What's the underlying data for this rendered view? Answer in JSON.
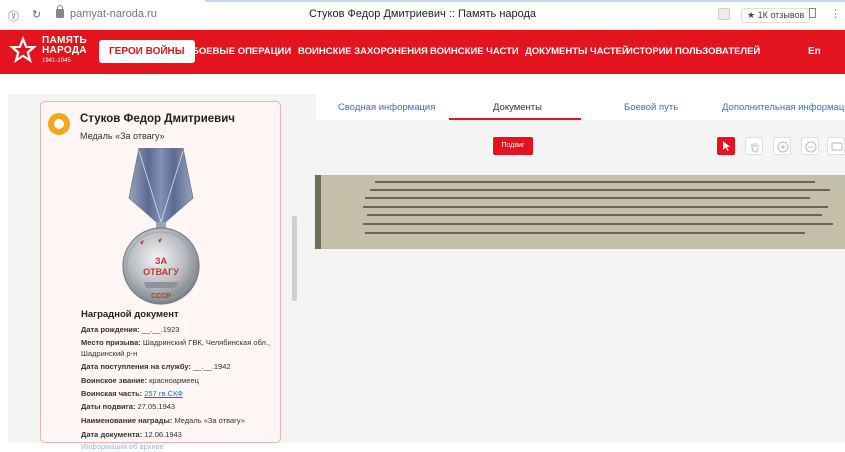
{
  "browser": {
    "url": "pamyat-naroda.ru",
    "tab_title": "Стуков Федор Дмитриевич :: Память народа",
    "reviews": "★ 1К отзывов"
  },
  "nav": {
    "logo_line1": "ПАМЯТЬ",
    "logo_line2": "НАРОДА",
    "logo_years": "1941-1945",
    "active_item": "ГЕРОИ ВОЙНЫ",
    "items": [
      "БОЕВЫЕ ОПЕРАЦИИ",
      "ВОИНСКИЕ ЗАХОРОНЕНИЯ",
      "ВОИНСКИЕ ЧАСТИ",
      "ДОКУМЕНТЫ ЧАСТЕЙ",
      "ИСТОРИИ ПОЛЬЗОВАТЕЛЕЙ"
    ],
    "lang": "En",
    "accent_color": "#e4141e"
  },
  "card": {
    "name": "Стуков Федор Дмитриевич",
    "medal": "Медаль «За отвагу»",
    "medal_text_top": "ЗА",
    "medal_text_bottom": "ОТВАГУ",
    "medal_text_ussr": "СССР",
    "doc_title": "Наградной документ",
    "fields": [
      {
        "label": "Дата рождения:",
        "value": "__.__.1923"
      },
      {
        "label": "Место призыва:",
        "value": "Шадринский ГВК, Челябинская обл., Шадринский р-н"
      },
      {
        "label": "Дата поступления на службу:",
        "value": "__.__.1942"
      },
      {
        "label": "Воинское звание:",
        "value": "красноармеец"
      },
      {
        "label": "Воинская часть:",
        "value": "257 гв СКФ"
      },
      {
        "label": "Даты подвига:",
        "value": "27.05.1943"
      },
      {
        "label": "Наименование награды:",
        "value": "Медаль «За отвагу»"
      },
      {
        "label": "Дата документа:",
        "value": "12.06.1943"
      }
    ],
    "faded_text": "Информация об архиве"
  },
  "tabs": [
    "Сводная информация",
    "Документы",
    "Боевой путь",
    "Дополнительная информация"
  ],
  "viewer": {
    "podvig_button": "Подвиг",
    "tools": [
      "cursor-icon",
      "hand-icon",
      "zoom-in-icon",
      "zoom-out-icon",
      "comment-icon"
    ]
  }
}
